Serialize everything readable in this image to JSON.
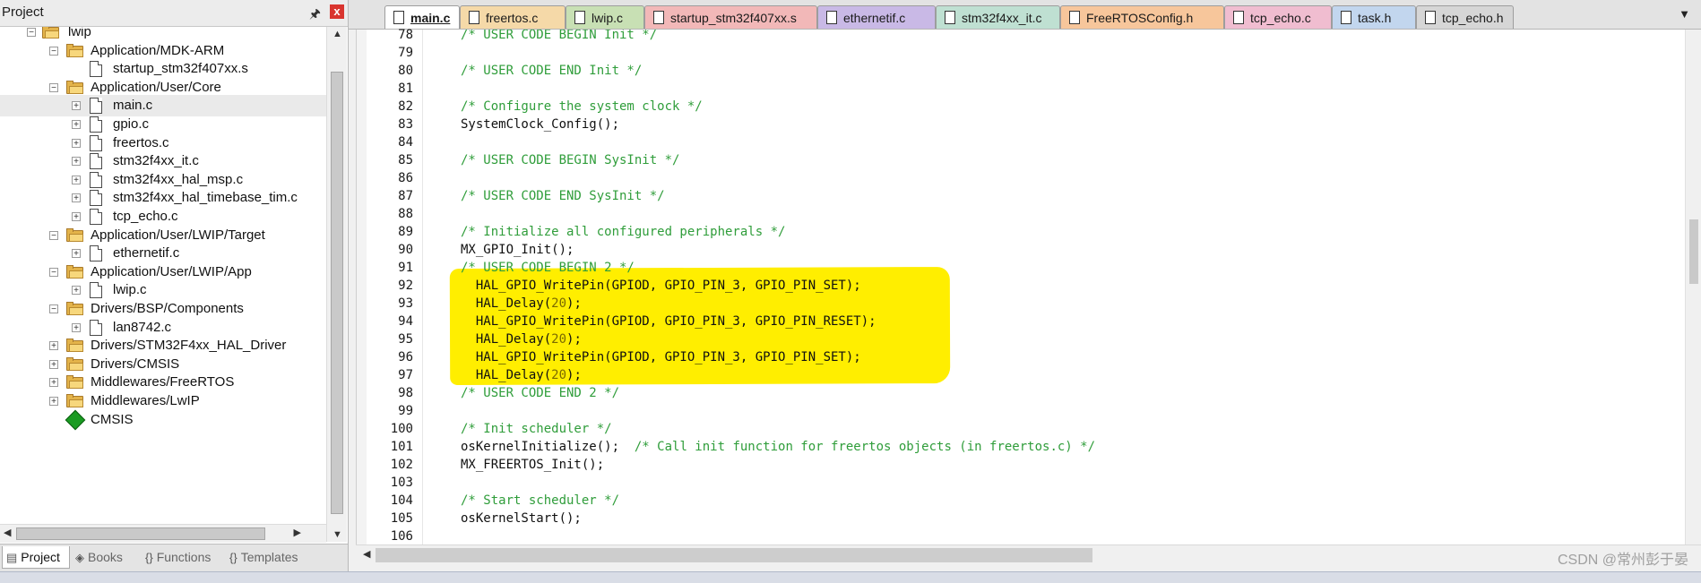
{
  "project_panel": {
    "title": "Project",
    "pin_icon": "pin-icon",
    "close_label": "x",
    "tree": [
      {
        "label": "lwip",
        "type": "root",
        "indent": 0,
        "expander": "-"
      },
      {
        "label": "Application/MDK-ARM",
        "type": "folder",
        "indent": 1,
        "expander": "-"
      },
      {
        "label": "startup_stm32f407xx.s",
        "type": "file",
        "indent": 2,
        "expander": ""
      },
      {
        "label": "Application/User/Core",
        "type": "folder",
        "indent": 1,
        "expander": "-"
      },
      {
        "label": "main.c",
        "type": "file",
        "indent": 2,
        "expander": "+",
        "selected": true
      },
      {
        "label": "gpio.c",
        "type": "file",
        "indent": 2,
        "expander": "+"
      },
      {
        "label": "freertos.c",
        "type": "file",
        "indent": 2,
        "expander": "+"
      },
      {
        "label": "stm32f4xx_it.c",
        "type": "file",
        "indent": 2,
        "expander": "+"
      },
      {
        "label": "stm32f4xx_hal_msp.c",
        "type": "file",
        "indent": 2,
        "expander": "+"
      },
      {
        "label": "stm32f4xx_hal_timebase_tim.c",
        "type": "file",
        "indent": 2,
        "expander": "+"
      },
      {
        "label": "tcp_echo.c",
        "type": "file",
        "indent": 2,
        "expander": "+"
      },
      {
        "label": "Application/User/LWIP/Target",
        "type": "folder",
        "indent": 1,
        "expander": "-"
      },
      {
        "label": "ethernetif.c",
        "type": "file",
        "indent": 2,
        "expander": "+"
      },
      {
        "label": "Application/User/LWIP/App",
        "type": "folder",
        "indent": 1,
        "expander": "-"
      },
      {
        "label": "lwip.c",
        "type": "file",
        "indent": 2,
        "expander": "+"
      },
      {
        "label": "Drivers/BSP/Components",
        "type": "folder",
        "indent": 1,
        "expander": "-"
      },
      {
        "label": "lan8742.c",
        "type": "file",
        "indent": 2,
        "expander": "+"
      },
      {
        "label": "Drivers/STM32F4xx_HAL_Driver",
        "type": "folder",
        "indent": 1,
        "expander": "+"
      },
      {
        "label": "Drivers/CMSIS",
        "type": "folder",
        "indent": 1,
        "expander": "+"
      },
      {
        "label": "Middlewares/FreeRTOS",
        "type": "folder",
        "indent": 1,
        "expander": "+"
      },
      {
        "label": "Middlewares/LwIP",
        "type": "folder",
        "indent": 1,
        "expander": "+"
      },
      {
        "label": "CMSIS",
        "type": "cmsis",
        "indent": 1,
        "expander": ""
      }
    ],
    "bottom_tabs": [
      {
        "label": "Project",
        "icon": "project-icon",
        "active": true
      },
      {
        "label": "Books",
        "icon": "books-icon",
        "active": false
      },
      {
        "label": "Functions",
        "icon": "functions-icon",
        "active": false
      },
      {
        "label": "Templates",
        "icon": "templates-icon",
        "active": false
      }
    ]
  },
  "editor": {
    "tabs": [
      {
        "label": "main.c",
        "color": "#ffffff",
        "active": true
      },
      {
        "label": "freertos.c",
        "color": "#f5d9a8"
      },
      {
        "label": "lwip.c",
        "color": "#c8e0b4"
      },
      {
        "label": "startup_stm32f407xx.s",
        "color": "#f2b8b8"
      },
      {
        "label": "ethernetif.c",
        "color": "#c9b9e6"
      },
      {
        "label": "stm32f4xx_it.c",
        "color": "#bfe0d2"
      },
      {
        "label": "FreeRTOSConfig.h",
        "color": "#f7c69b"
      },
      {
        "label": "tcp_echo.c",
        "color": "#f0bdd0"
      },
      {
        "label": "task.h",
        "color": "#c2d6ee"
      },
      {
        "label": "tcp_echo.h",
        "color": "#d6d6d6"
      }
    ],
    "overflow_icon": "chevron-down-icon",
    "lines": [
      {
        "n": "78",
        "text": "/* USER CODE BEGIN Init */",
        "kind": "comment"
      },
      {
        "n": "79",
        "text": "",
        "kind": "code"
      },
      {
        "n": "80",
        "text": "/* USER CODE END Init */",
        "kind": "comment"
      },
      {
        "n": "81",
        "text": "",
        "kind": "code"
      },
      {
        "n": "82",
        "text": "/* Configure the system clock */",
        "kind": "comment"
      },
      {
        "n": "83",
        "text": "SystemClock_Config();",
        "kind": "code"
      },
      {
        "n": "84",
        "text": "",
        "kind": "code"
      },
      {
        "n": "85",
        "text": "/* USER CODE BEGIN SysInit */",
        "kind": "comment"
      },
      {
        "n": "86",
        "text": "",
        "kind": "code"
      },
      {
        "n": "87",
        "text": "/* USER CODE END SysInit */",
        "kind": "comment"
      },
      {
        "n": "88",
        "text": "",
        "kind": "code"
      },
      {
        "n": "89",
        "text": "/* Initialize all configured peripherals */",
        "kind": "comment"
      },
      {
        "n": "90",
        "text": "MX_GPIO_Init();",
        "kind": "code"
      },
      {
        "n": "91",
        "text": "/* USER CODE BEGIN 2 */",
        "kind": "comment"
      },
      {
        "n": "92",
        "text": "  HAL_GPIO_WritePin(GPIOD, GPIO_PIN_3, GPIO_PIN_SET);",
        "kind": "code"
      },
      {
        "n": "93",
        "text": "  HAL_Delay(20);",
        "kind": "code"
      },
      {
        "n": "94",
        "text": "  HAL_GPIO_WritePin(GPIOD, GPIO_PIN_3, GPIO_PIN_RESET);",
        "kind": "code"
      },
      {
        "n": "95",
        "text": "  HAL_Delay(20);",
        "kind": "code"
      },
      {
        "n": "96",
        "text": "  HAL_GPIO_WritePin(GPIOD, GPIO_PIN_3, GPIO_PIN_SET);",
        "kind": "code"
      },
      {
        "n": "97",
        "text": "  HAL_Delay(20);",
        "kind": "code"
      },
      {
        "n": "98",
        "text": "/* USER CODE END 2 */",
        "kind": "comment"
      },
      {
        "n": "99",
        "text": "",
        "kind": "code"
      },
      {
        "n": "100",
        "text": "/* Init scheduler */",
        "kind": "comment"
      },
      {
        "n": "101",
        "text": "osKernelInitialize();  /* Call init function for freertos objects (in freertos.c) */",
        "kind": "mixed",
        "code_part": "osKernelInitialize();  ",
        "comment_part": "/* Call init function for freertos objects (in freertos.c) */"
      },
      {
        "n": "102",
        "text": "MX_FREERTOS_Init();",
        "kind": "code"
      },
      {
        "n": "103",
        "text": "",
        "kind": "code"
      },
      {
        "n": "104",
        "text": "/* Start scheduler */",
        "kind": "comment"
      },
      {
        "n": "105",
        "text": "osKernelStart();",
        "kind": "code"
      },
      {
        "n": "106",
        "text": "",
        "kind": "code"
      }
    ],
    "highlight_color": "#ffee00",
    "comment_color": "#2f9d3a"
  },
  "watermark": "CSDN @常州彭于晏"
}
